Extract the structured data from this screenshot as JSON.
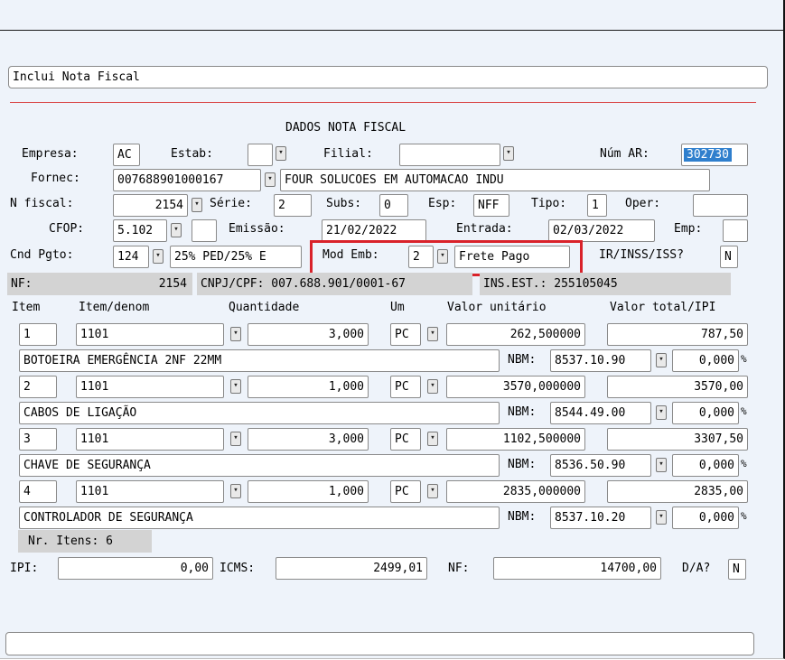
{
  "form_title": "Inclui Nota Fiscal",
  "section_title": "DADOS NOTA FISCAL",
  "header": {
    "empresa_label": "Empresa:",
    "empresa": "AC",
    "estab_label": "Estab:",
    "estab": "",
    "filial_label": "Filial:",
    "filial": "",
    "num_ar_label": "Núm AR:",
    "num_ar": "302730",
    "fornec_label": "Fornec:",
    "fornec_code": "007688901000167",
    "fornec_name": "FOUR SOLUCOES EM AUTOMACAO INDU",
    "nfiscal_label": "N fiscal:",
    "nfiscal": "2154",
    "serie_label": "Série:",
    "serie": "2",
    "subs_label": "Subs:",
    "subs": "0",
    "esp_label": "Esp:",
    "esp": "NFF",
    "tipo_label": "Tipo:",
    "tipo": "1",
    "oper_label": "Oper:",
    "oper": "",
    "cfop_label": "CFOP:",
    "cfop": "5.102",
    "cfop_extra": "",
    "emissao_label": "Emissão:",
    "emissao": "21/02/2022",
    "entrada_label": "Entrada:",
    "entrada": "02/03/2022",
    "emp_label": "Emp:",
    "emp": "",
    "cnd_label": "Cnd Pgto:",
    "cnd": "124",
    "cnd_desc": "25% PED/25% E",
    "modemb_label": "Mod Emb:",
    "modemb": "2",
    "modemb_desc": "Frete Pago",
    "irinss_label": "IR/INSS/ISS?",
    "irinss": "N"
  },
  "info_bar": {
    "nf_label": "NF:",
    "nf_value": "2154",
    "cnpj": "CNPJ/CPF: 007.688.901/0001-67",
    "ins": "INS.EST.: 255105045"
  },
  "table_headers": {
    "item": "Item",
    "item_denom": "Item/denom",
    "quantidade": "Quantidade",
    "um": "Um",
    "valor_unitario": "Valor unitário",
    "valor_total": "Valor total/IPI"
  },
  "nbm_label": "NBM:",
  "pct_sign": "%",
  "items": [
    {
      "item": "1",
      "code": "1101",
      "qty": "3,000",
      "um": "PC",
      "unit": "262,500000",
      "total": "787,50",
      "desc": "BOTOEIRA EMERGÊNCIA 2NF 22MM",
      "nbm": "8537.10.90",
      "ipi": "0,000"
    },
    {
      "item": "2",
      "code": "1101",
      "qty": "1,000",
      "um": "PC",
      "unit": "3570,000000",
      "total": "3570,00",
      "desc": "CABOS DE LIGAÇÃO",
      "nbm": "8544.49.00",
      "ipi": "0,000"
    },
    {
      "item": "3",
      "code": "1101",
      "qty": "3,000",
      "um": "PC",
      "unit": "1102,500000",
      "total": "3307,50",
      "desc": "CHAVE DE SEGURANÇA",
      "nbm": "8536.50.90",
      "ipi": "0,000"
    },
    {
      "item": "4",
      "code": "1101",
      "qty": "1,000",
      "um": "PC",
      "unit": "2835,000000",
      "total": "2835,00",
      "desc": "CONTROLADOR DE SEGURANÇA",
      "nbm": "8537.10.20",
      "ipi": "0,000"
    }
  ],
  "nr_itens": "Nr. Itens: 6",
  "totals": {
    "ipi_label": "IPI:",
    "ipi": "0,00",
    "icms_label": "ICMS:",
    "icms": "2499,01",
    "nf_label": "NF:",
    "nf": "14700,00",
    "da_label": "D/A?",
    "da": "N"
  },
  "status_bar": "",
  "colors": {
    "highlight_border": "#d9222a",
    "selection": "#2f7fcd",
    "info_bar": "#d3d3d3",
    "background": "#eef3fa"
  }
}
